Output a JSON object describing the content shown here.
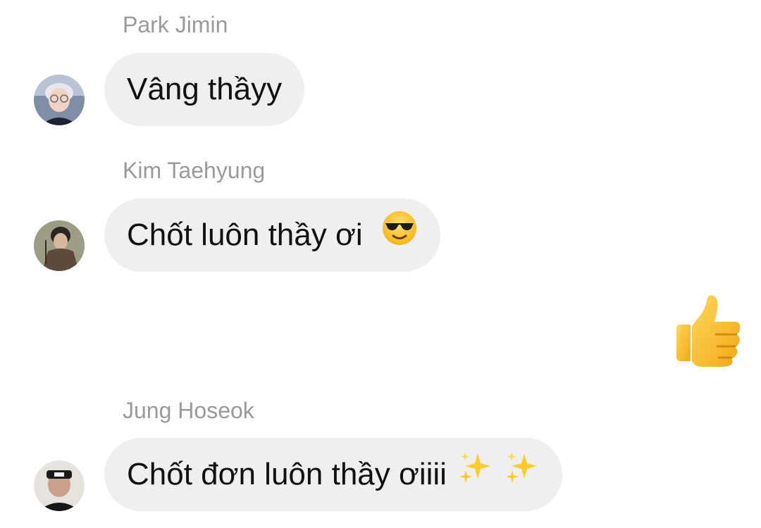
{
  "messages": [
    {
      "sender": "Park Jimin",
      "text": "Vâng thầyy",
      "emoji": null,
      "avatar_icon": "user-avatar-park-jimin"
    },
    {
      "sender": "Kim Taehyung",
      "text": "Chốt luôn thầy ơi",
      "emoji": "sunglasses-face-icon",
      "avatar_icon": "user-avatar-kim-taehyung"
    },
    {
      "sender": "Jung Hoseok",
      "text": "Chốt đơn luôn thầy ơiiii",
      "emoji": "sparkles-icon",
      "avatar_icon": "user-avatar-jung-hoseok"
    }
  ],
  "outgoing": {
    "emoji": "thumbs-up-icon"
  },
  "colors": {
    "bubble_bg": "#efefef",
    "sender_text": "#9a9a9a",
    "message_text": "#111111",
    "background": "#ffffff"
  }
}
